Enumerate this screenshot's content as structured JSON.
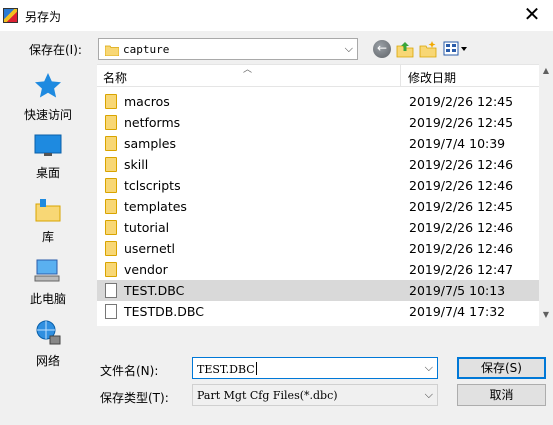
{
  "window": {
    "title": "另存为",
    "close_glyph": "✕"
  },
  "location": {
    "label": "保存在(I):",
    "value": "capture"
  },
  "toolbar": {
    "back_icon": "back-icon",
    "up_icon": "up-folder-icon",
    "new_folder_icon": "new-folder-icon",
    "view_icon": "view-menu-icon"
  },
  "places": [
    {
      "label": "快速访问",
      "icon": "star-icon"
    },
    {
      "label": "桌面",
      "icon": "desktop-icon"
    },
    {
      "label": "库",
      "icon": "library-icon"
    },
    {
      "label": "此电脑",
      "icon": "computer-icon"
    },
    {
      "label": "网络",
      "icon": "network-icon"
    }
  ],
  "list": {
    "columns": [
      "名称",
      "修改日期"
    ],
    "rows": [
      {
        "name": "macros",
        "date": "2019/2/26 12:45",
        "type": "folder"
      },
      {
        "name": "netforms",
        "date": "2019/2/26 12:45",
        "type": "folder"
      },
      {
        "name": "samples",
        "date": "2019/7/4 10:39",
        "type": "folder"
      },
      {
        "name": "skill",
        "date": "2019/2/26 12:46",
        "type": "folder"
      },
      {
        "name": "tclscripts",
        "date": "2019/2/26 12:46",
        "type": "folder"
      },
      {
        "name": "templates",
        "date": "2019/2/26 12:45",
        "type": "folder"
      },
      {
        "name": "tutorial",
        "date": "2019/2/26 12:46",
        "type": "folder"
      },
      {
        "name": "usernetl",
        "date": "2019/2/26 12:46",
        "type": "folder"
      },
      {
        "name": "vendor",
        "date": "2019/2/26 12:47",
        "type": "folder"
      },
      {
        "name": "TEST.DBC",
        "date": "2019/7/5 10:13",
        "type": "file",
        "selected": true
      },
      {
        "name": "TESTDB.DBC",
        "date": "2019/7/4 17:32",
        "type": "file"
      }
    ]
  },
  "form": {
    "filename_label": "文件名(N):",
    "filename_value": "TEST.DBC",
    "filetype_label": "保存类型(T):",
    "filetype_value": "Part Mgt Cfg Files(*.dbc)",
    "save_label": "保存(S)",
    "cancel_label": "取消"
  },
  "colors": {
    "accent": "#0078d7",
    "selected_row": "#d9d9d9",
    "folder": "#f8d775"
  }
}
